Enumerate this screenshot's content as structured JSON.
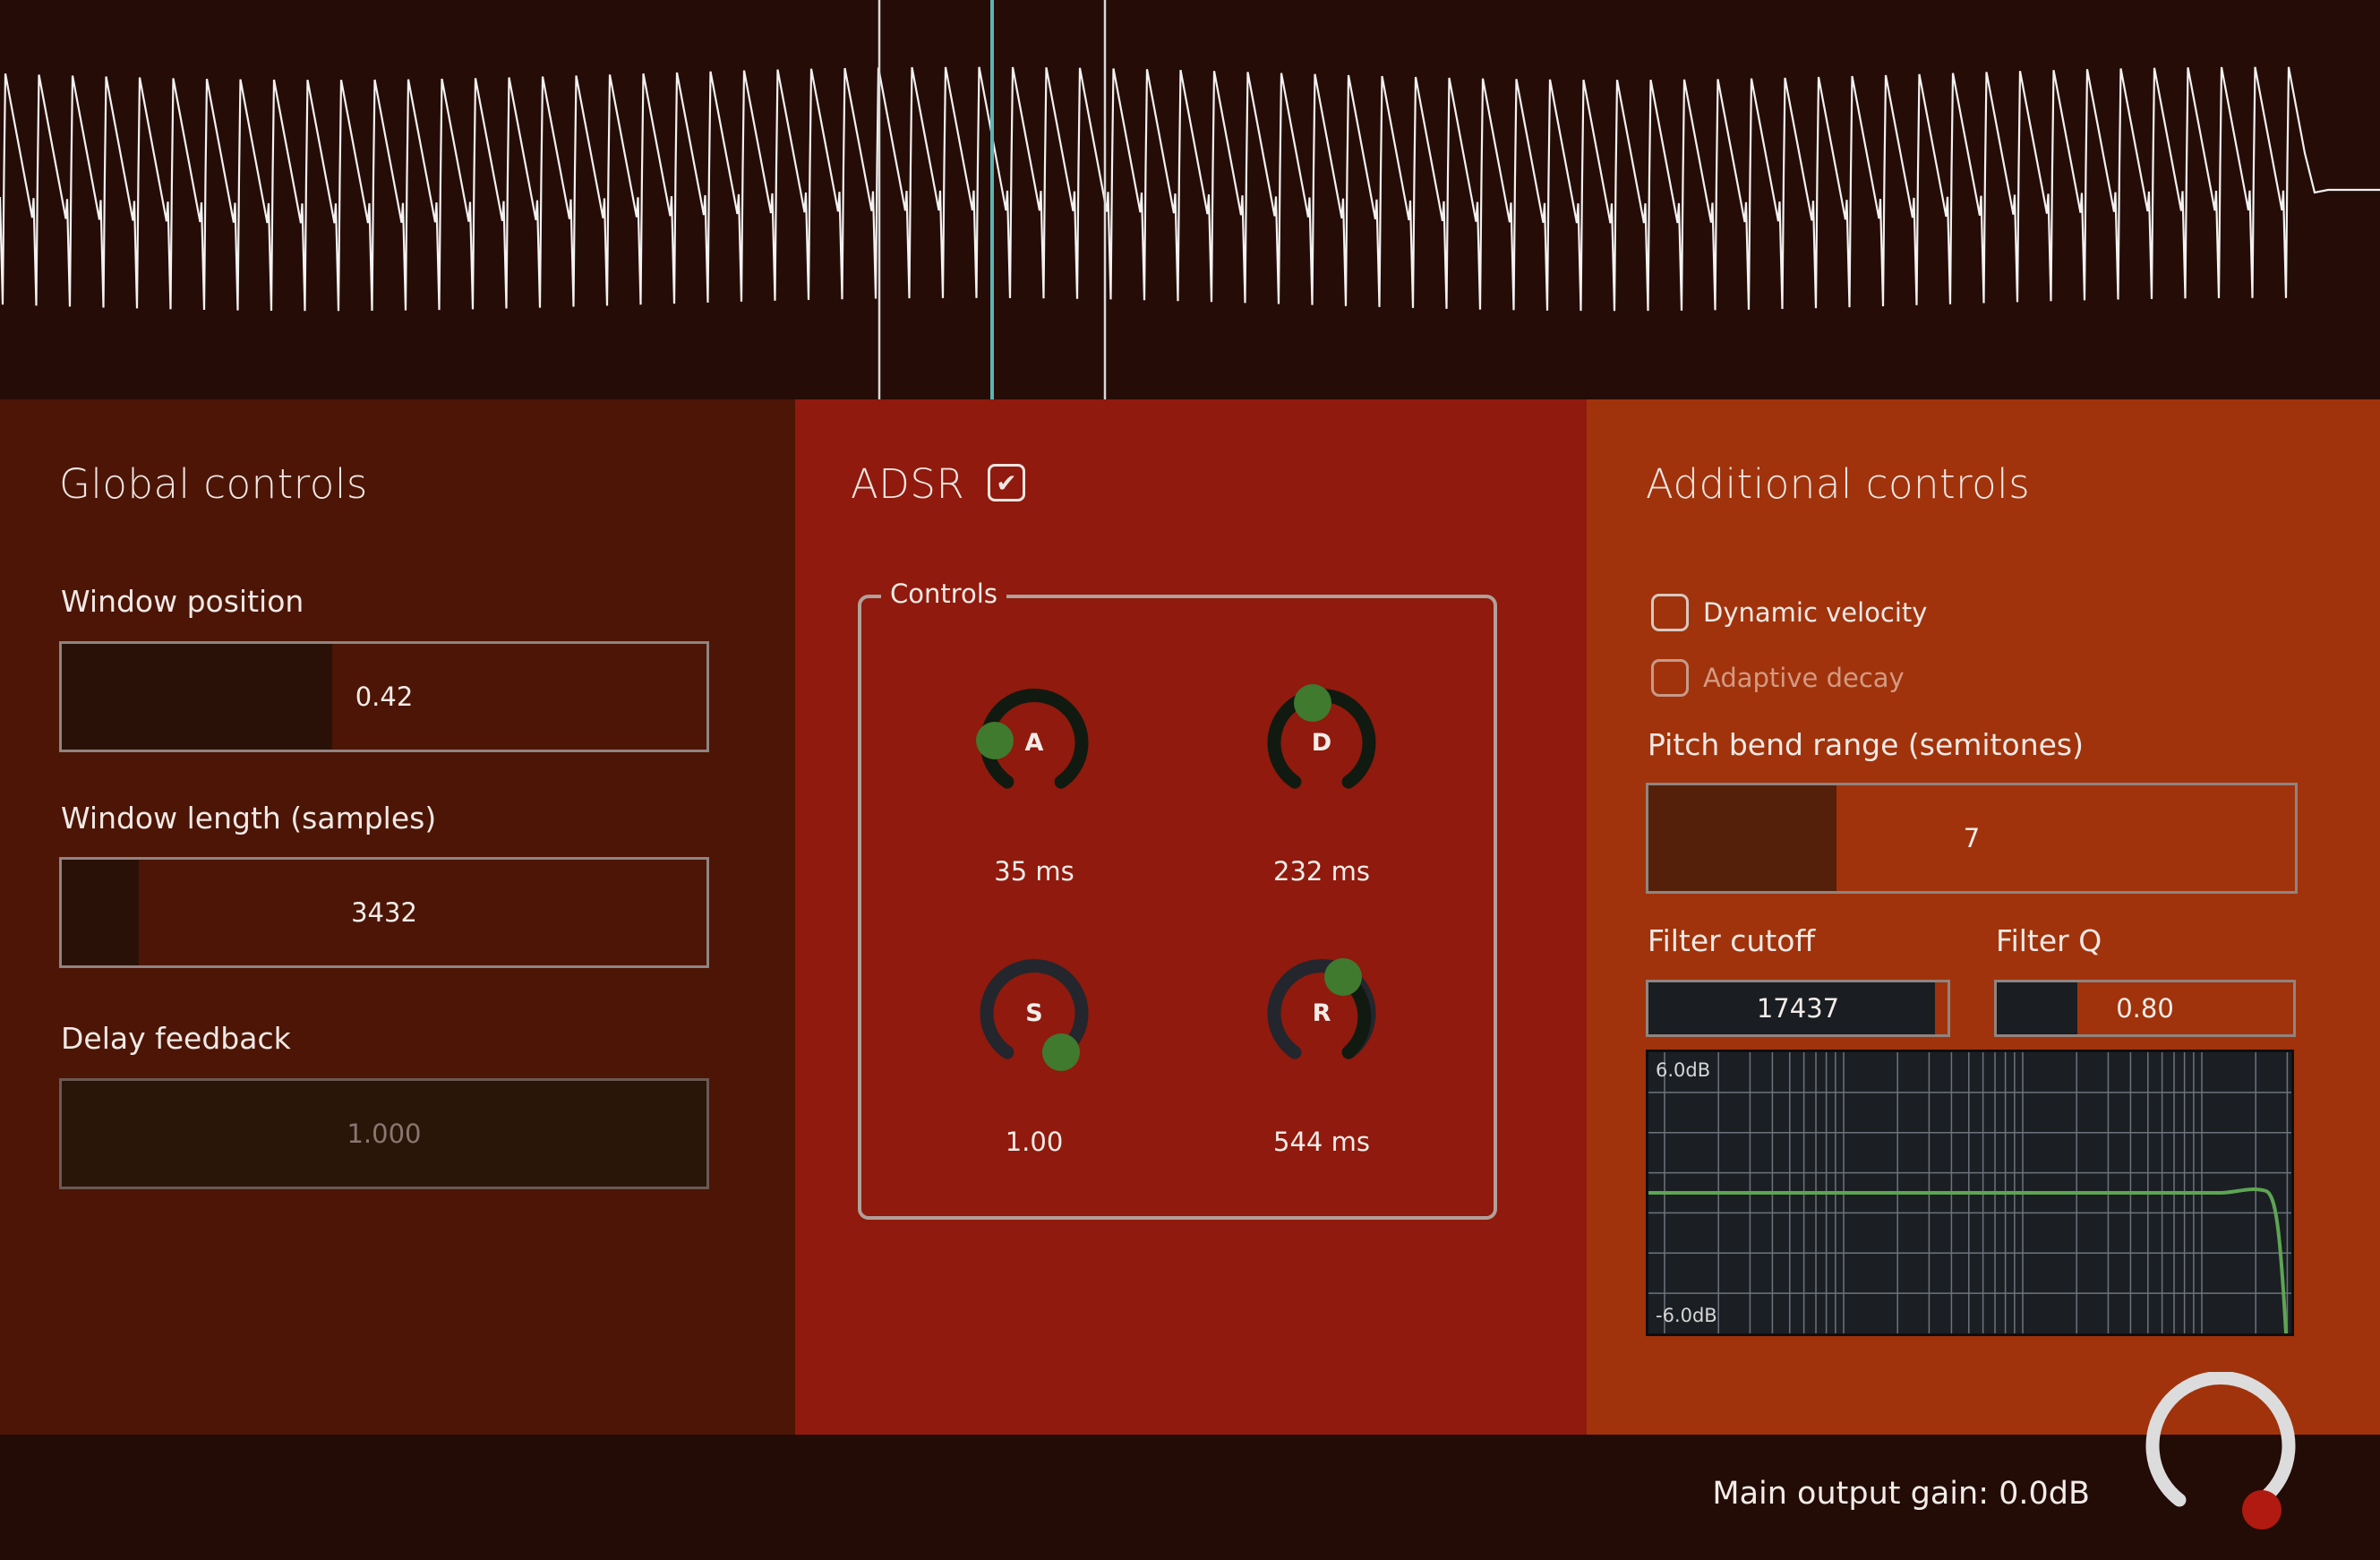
{
  "global_controls": {
    "title": "Global controls",
    "window_position": {
      "label": "Window position",
      "value": "0.42",
      "fill_fraction": 0.42
    },
    "window_length": {
      "label": "Window length (samples)",
      "value": "3432",
      "fill_fraction": 0.12
    },
    "delay_feedback": {
      "label": "Delay feedback",
      "value": "1.000",
      "fill_fraction": 1.0,
      "disabled": true
    }
  },
  "adsr": {
    "title": "ADSR",
    "enabled_mark": "✔",
    "controls_legend": "Controls",
    "knobs": [
      {
        "letter": "A",
        "value": "35 ms"
      },
      {
        "letter": "D",
        "value": "232 ms"
      },
      {
        "letter": "S",
        "value": "1.00"
      },
      {
        "letter": "R",
        "value": "544 ms"
      }
    ]
  },
  "additional_controls": {
    "title": "Additional controls",
    "dynamic_velocity": {
      "label": "Dynamic velocity",
      "checked": false
    },
    "adaptive_decay": {
      "label": "Adaptive decay",
      "checked": false,
      "disabled": true
    },
    "pitch_bend": {
      "label": "Pitch bend range (semitones)",
      "value": "7",
      "fill_fraction": 0.29
    },
    "filter_cutoff": {
      "label": "Filter cutoff",
      "value": "17437",
      "fill_fraction": 0.95
    },
    "filter_q": {
      "label": "Filter Q",
      "value": "0.80",
      "fill_fraction": 0.27
    },
    "graph": {
      "top_label": "6.0dB",
      "bottom_label": "-6.0dB"
    }
  },
  "footer": {
    "gain_label": "Main output gain: 0.0dB"
  },
  "colors": {
    "knob_handle": "#3f7a2f",
    "curve": "#5da552",
    "playhead": "#5fb3b3",
    "gain_handle": "#b01a10"
  }
}
